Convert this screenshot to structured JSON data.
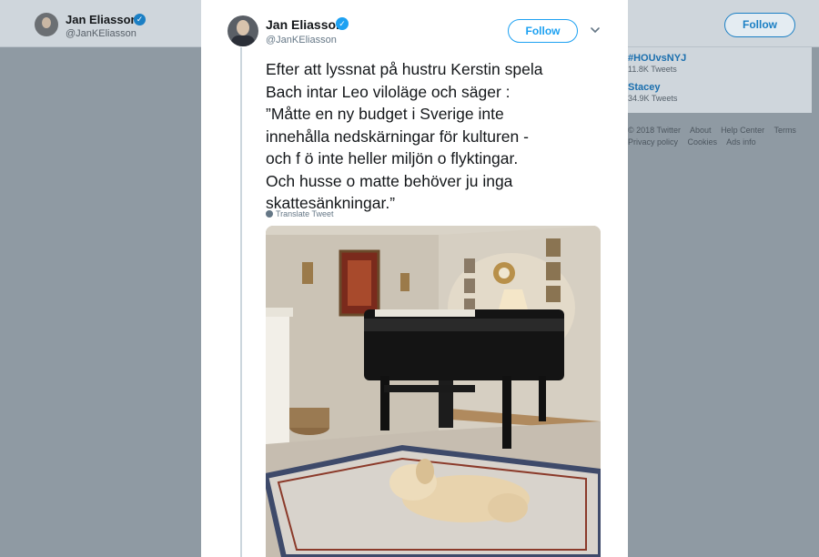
{
  "background": {
    "profile_name": "Jan Eliasson",
    "profile_handle": "@JanKEliasson",
    "follow_label": "Follow",
    "trends": [
      {
        "name": "#HOUvsNYJ",
        "count": "11.8K Tweets"
      },
      {
        "name": "Stacey",
        "count": "34.9K Tweets"
      }
    ],
    "footer_row1": [
      "© 2018 Twitter",
      "About",
      "Help Center",
      "Terms"
    ],
    "footer_row2": [
      "Privacy policy",
      "Cookies",
      "Ads info"
    ]
  },
  "tweet": {
    "author_name": "Jan Eliasson",
    "author_handle": "@JanKEliasson",
    "follow_label": "Follow",
    "text": "Efter att lyssnat på hustru Kerstin spela\nBach intar Leo viloläge och säger :\n”Måtte en ny budget i Sverige inte\ninnehålla nedskärningar för kulturen -\noch f ö inte heller miljön o flyktingar.\nOch husse o matte behöver ju inga\nskattesänkningar.”",
    "translate_label": "Translate Tweet"
  },
  "icons": {
    "verified": "verified-badge-icon",
    "chevron": "chevron-down-icon",
    "globe": "globe-icon"
  },
  "colors": {
    "accent": "#1da1f2",
    "overlay": "#8f9aa3"
  }
}
